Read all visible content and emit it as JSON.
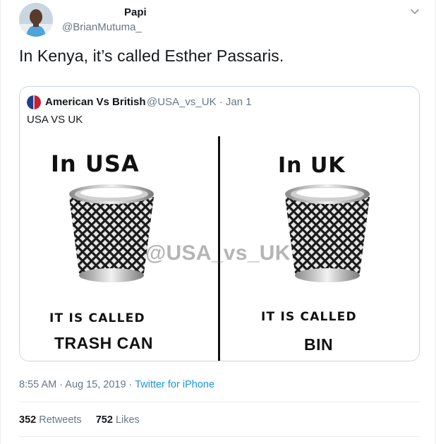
{
  "author": {
    "name": "Papi",
    "handle": "@BrianMutuma_"
  },
  "tweet_text": "In Kenya, it’s called Esther Passaris.",
  "quoted_tweet": {
    "name": "American Vs British",
    "handle_date": "@USA_vs_UK · Jan 1",
    "text": "USA VS UK",
    "meme": {
      "left_heading": "In USA",
      "right_heading": "In UK",
      "left_called": "IT IS CALLED",
      "right_called": "IT IS CALLED",
      "left_answer": "TRASH CAN",
      "right_answer": "BIN",
      "watermark": "@USA_vs_UK"
    }
  },
  "meta": {
    "time_date": "8:55 AM · Aug 15, 2019 · ",
    "source": "Twitter for iPhone"
  },
  "stats": {
    "retweets_count": "352",
    "retweets_label": "Retweets",
    "likes_count": "752",
    "likes_label": "Likes"
  },
  "icons": {
    "caret": "chevron-down-icon"
  },
  "colors": {
    "link": "#1b95e0",
    "secondary_text": "#657786",
    "border": "#ccd6dd"
  }
}
